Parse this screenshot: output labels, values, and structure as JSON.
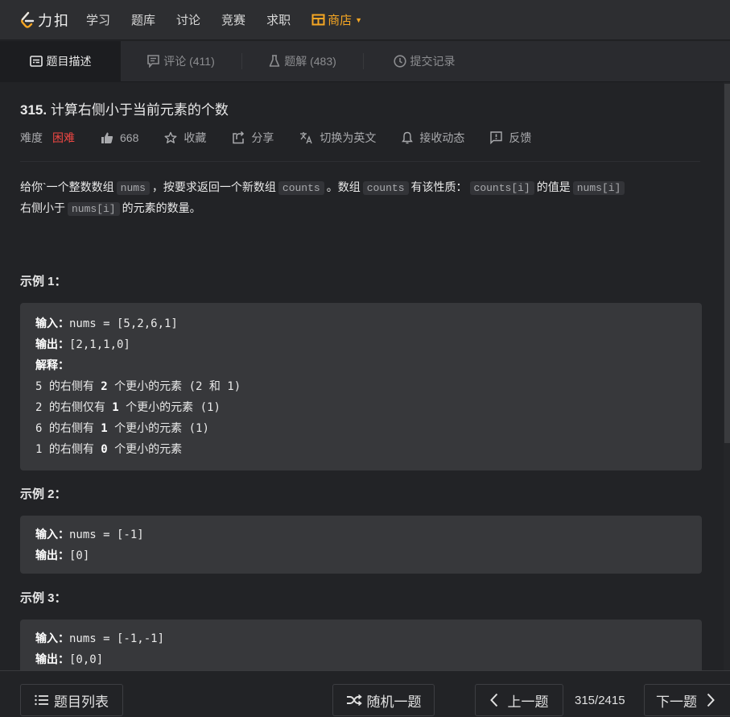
{
  "nav": {
    "brand": "力扣",
    "items": [
      "学习",
      "题库",
      "讨论",
      "竞赛",
      "求职"
    ],
    "store": "商店",
    "store_color": "#f5a623"
  },
  "tabs": [
    {
      "label": "题目描述",
      "icon": "description-icon",
      "active": true
    },
    {
      "label": "评论 (411)",
      "icon": "comment-icon",
      "active": false
    },
    {
      "label": "题解 (483)",
      "icon": "flask-icon",
      "active": false
    },
    {
      "label": "提交记录",
      "icon": "clock-icon",
      "active": false
    }
  ],
  "problem": {
    "number": "315.",
    "title": "计算右侧小于当前元素的个数",
    "difficulty_label": "难度",
    "difficulty": "困难",
    "difficulty_color": "#ef4743",
    "likes": "668",
    "actions": {
      "favorite": "收藏",
      "share": "分享",
      "translate": "切换为英文",
      "subscribe": "接收动态",
      "feedback": "反馈"
    },
    "description": {
      "p1": "给你`一个整数数组",
      "c1": "nums",
      "p2": "，按要求返回一个新数组",
      "c2": "counts",
      "p3": "。数组",
      "c3": "counts",
      "p4": "有该性质：",
      "c4": "counts[i]",
      "p5": "的值是",
      "c5": "nums[i]",
      "p6": "右侧小于",
      "c6": "nums[i]",
      "p7": "的元素的数量。"
    }
  },
  "examples": [
    {
      "title": "示例 1：",
      "input_label": "输入：",
      "input": "nums = [5,2,6,1]",
      "output_label": "输出：",
      "output": "[2,1,1,0]",
      "explain_label": "解释：",
      "explain": [
        {
          "a": "5",
          "b": " 的右侧有 ",
          "n": "2",
          "c": " 个更小的元素 (2 和 1)"
        },
        {
          "a": "2",
          "b": " 的右侧仅有 ",
          "n": "1",
          "c": " 个更小的元素 (1)"
        },
        {
          "a": "6",
          "b": " 的右侧有 ",
          "n": "1",
          "c": " 个更小的元素 (1)"
        },
        {
          "a": "1",
          "b": " 的右侧有 ",
          "n": "0",
          "c": " 个更小的元素"
        }
      ]
    },
    {
      "title": "示例 2：",
      "input_label": "输入：",
      "input": "nums = [-1]",
      "output_label": "输出：",
      "output": "[0]"
    },
    {
      "title": "示例 3：",
      "input_label": "输入：",
      "input": "nums = [-1,-1]",
      "output_label": "输出：",
      "output": "[0,0]"
    }
  ],
  "footer": {
    "list": "题目列表",
    "random": "随机一题",
    "prev": "上一题",
    "page": "315/2415",
    "next": "下一题"
  }
}
